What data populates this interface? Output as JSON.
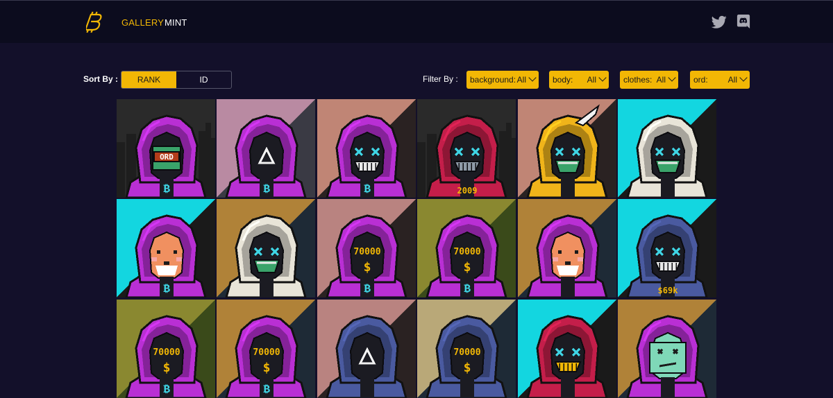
{
  "header": {
    "logo_icon": "bitcoin-logo-icon",
    "nav": [
      {
        "label": "GALLERY",
        "active": true
      },
      {
        "label": "MINT",
        "active": false
      }
    ],
    "social": [
      {
        "icon": "twitter-icon"
      },
      {
        "icon": "discord-icon"
      }
    ]
  },
  "sort": {
    "label": "Sort By :",
    "options": [
      {
        "label": "RANK",
        "active": true
      },
      {
        "label": "ID",
        "active": false
      }
    ]
  },
  "filters": {
    "label": "Filter By :",
    "items": [
      {
        "label": "background:",
        "value": "All"
      },
      {
        "label": "body:",
        "value": "All"
      },
      {
        "label": "clothes:",
        "value": "All"
      },
      {
        "label": "ord:",
        "value": "All"
      }
    ]
  },
  "colors": {
    "accent": "#f2b705",
    "page_bg": "#13102a",
    "header_bg": "#0c0c1e"
  },
  "gallery": [
    {
      "bg": "#2a2a2a",
      "bg2": "#2a2a2a",
      "city": true,
      "hood": "#b92fd4",
      "eyes": "ord",
      "mouth": "none",
      "chest": "bitcoin",
      "face_text": "ORD"
    },
    {
      "bg": "#b98aa2",
      "bg2": "#3a3a44",
      "city": false,
      "hood": "#b92fd4",
      "eyes": "triangle",
      "mouth": "none",
      "chest": "bitcoin"
    },
    {
      "bg": "#c08575",
      "bg2": "#2a2222",
      "city": false,
      "hood": "#b92fd4",
      "eyes": "x",
      "mouth": "grin",
      "chest": "bitcoin"
    },
    {
      "bg": "#2a2a2a",
      "bg2": "#2a2a2a",
      "city": true,
      "hood": "#c41e4a",
      "eyes": "x",
      "mouth": "grin-grey",
      "chest": "text",
      "chest_text": "2009"
    },
    {
      "bg": "#c08575",
      "bg2": "#2a2222",
      "city": false,
      "hood": "#f0b41a",
      "eyes": "x",
      "mouth": "green",
      "chest": "none",
      "horn": true
    },
    {
      "bg": "#13d6e0",
      "bg2": "#1a1a1a",
      "city": false,
      "hood": "#e8e4d8",
      "eyes": "x",
      "mouth": "green",
      "chest": "none"
    },
    {
      "bg": "#13d6e0",
      "bg2": "#1a1a1a",
      "city": false,
      "hood": "#b92fd4",
      "eyes": "dog",
      "mouth": "none",
      "chest": "bitcoin"
    },
    {
      "bg": "#b08238",
      "bg2": "#1e2a36",
      "city": false,
      "hood": "#e8e4d8",
      "eyes": "x",
      "mouth": "green",
      "chest": "none"
    },
    {
      "bg": "#b98380",
      "bg2": "#2a2222",
      "city": false,
      "hood": "#b92fd4",
      "eyes": "number",
      "mouth": "dollar",
      "chest": "bitcoin",
      "face_text": "70000"
    },
    {
      "bg": "#8a8830",
      "bg2": "#3a4a1a",
      "city": false,
      "hood": "#b92fd4",
      "eyes": "number",
      "mouth": "dollar",
      "chest": "bitcoin",
      "face_text": "70000"
    },
    {
      "bg": "#b08238",
      "bg2": "#1e2a36",
      "city": false,
      "hood": "#b92fd4",
      "eyes": "dog",
      "mouth": "none",
      "chest": "none"
    },
    {
      "bg": "#13d6e0",
      "bg2": "#1a1a1a",
      "city": false,
      "hood": "#4a5aa0",
      "eyes": "x",
      "mouth": "white-grin",
      "chest": "text",
      "chest_text": "$69k"
    },
    {
      "bg": "#8a8830",
      "bg2": "#3a4a1a",
      "city": false,
      "hood": "#b92fd4",
      "eyes": "number",
      "mouth": "dollar",
      "chest": "bitcoin",
      "face_text": "70000"
    },
    {
      "bg": "#b08238",
      "bg2": "#1e2a36",
      "city": false,
      "hood": "#b92fd4",
      "eyes": "number",
      "mouth": "dollar",
      "chest": "bitcoin",
      "face_text": "70000"
    },
    {
      "bg": "#b98380",
      "bg2": "#2a2222",
      "city": false,
      "hood": "#4a5aa0",
      "eyes": "triangle",
      "mouth": "none",
      "chest": "none"
    },
    {
      "bg": "#b9a878",
      "bg2": "#1e2a36",
      "city": false,
      "hood": "#4a5aa0",
      "eyes": "number",
      "mouth": "dollar",
      "chest": "none",
      "face_text": "70000"
    },
    {
      "bg": "#13d6e0",
      "bg2": "#1a1a1a",
      "city": false,
      "hood": "#c41e4a",
      "eyes": "x",
      "mouth": "yellow-grin",
      "chest": "none"
    },
    {
      "bg": "#b08238",
      "bg2": "#1e2a36",
      "city": false,
      "hood": "#b92fd4",
      "eyes": "zombie",
      "mouth": "none",
      "chest": "none"
    }
  ]
}
